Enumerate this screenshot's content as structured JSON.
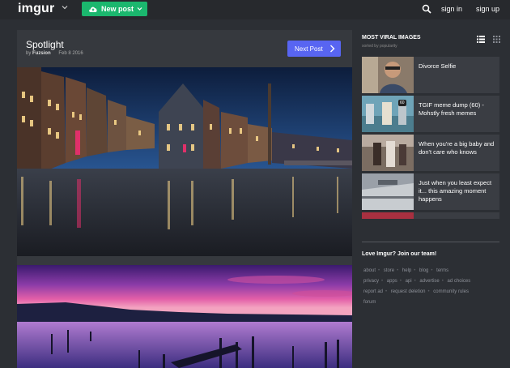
{
  "header": {
    "logo": "imgur",
    "new_post_label": "New post",
    "signin_label": "sign in",
    "signup_label": "sign up"
  },
  "post": {
    "title": "Spotlight",
    "by_prefix": "by",
    "author": "Fuzsion",
    "date": "Feb 8 2016",
    "next_label": "Next Post"
  },
  "sidebar": {
    "title": "MOST VIRAL IMAGES",
    "subtitle": "sorted by popularity",
    "items": [
      {
        "label": "Divorce Selfie"
      },
      {
        "label": "TGIF meme dump (60) - Mohstly fresh memes",
        "badge": "60"
      },
      {
        "label": "When you're a big baby and don't care who knows"
      },
      {
        "label": "Just when you least expect it... this amazing moment happens"
      }
    ],
    "join_team": "Love Imgur? Join our team!",
    "footer_rows": [
      [
        "about",
        "store",
        "help",
        "blog",
        "terms"
      ],
      [
        "privacy",
        "apps",
        "api",
        "advertise",
        "ad choices"
      ],
      [
        "report ad",
        "request deletion",
        "community rules"
      ],
      [
        "forum"
      ]
    ]
  },
  "colors": {
    "background": "#2c2f34",
    "topbar": "#27292d",
    "new_post_green": "#1bb76e",
    "next_post_blue": "#5865f2"
  }
}
